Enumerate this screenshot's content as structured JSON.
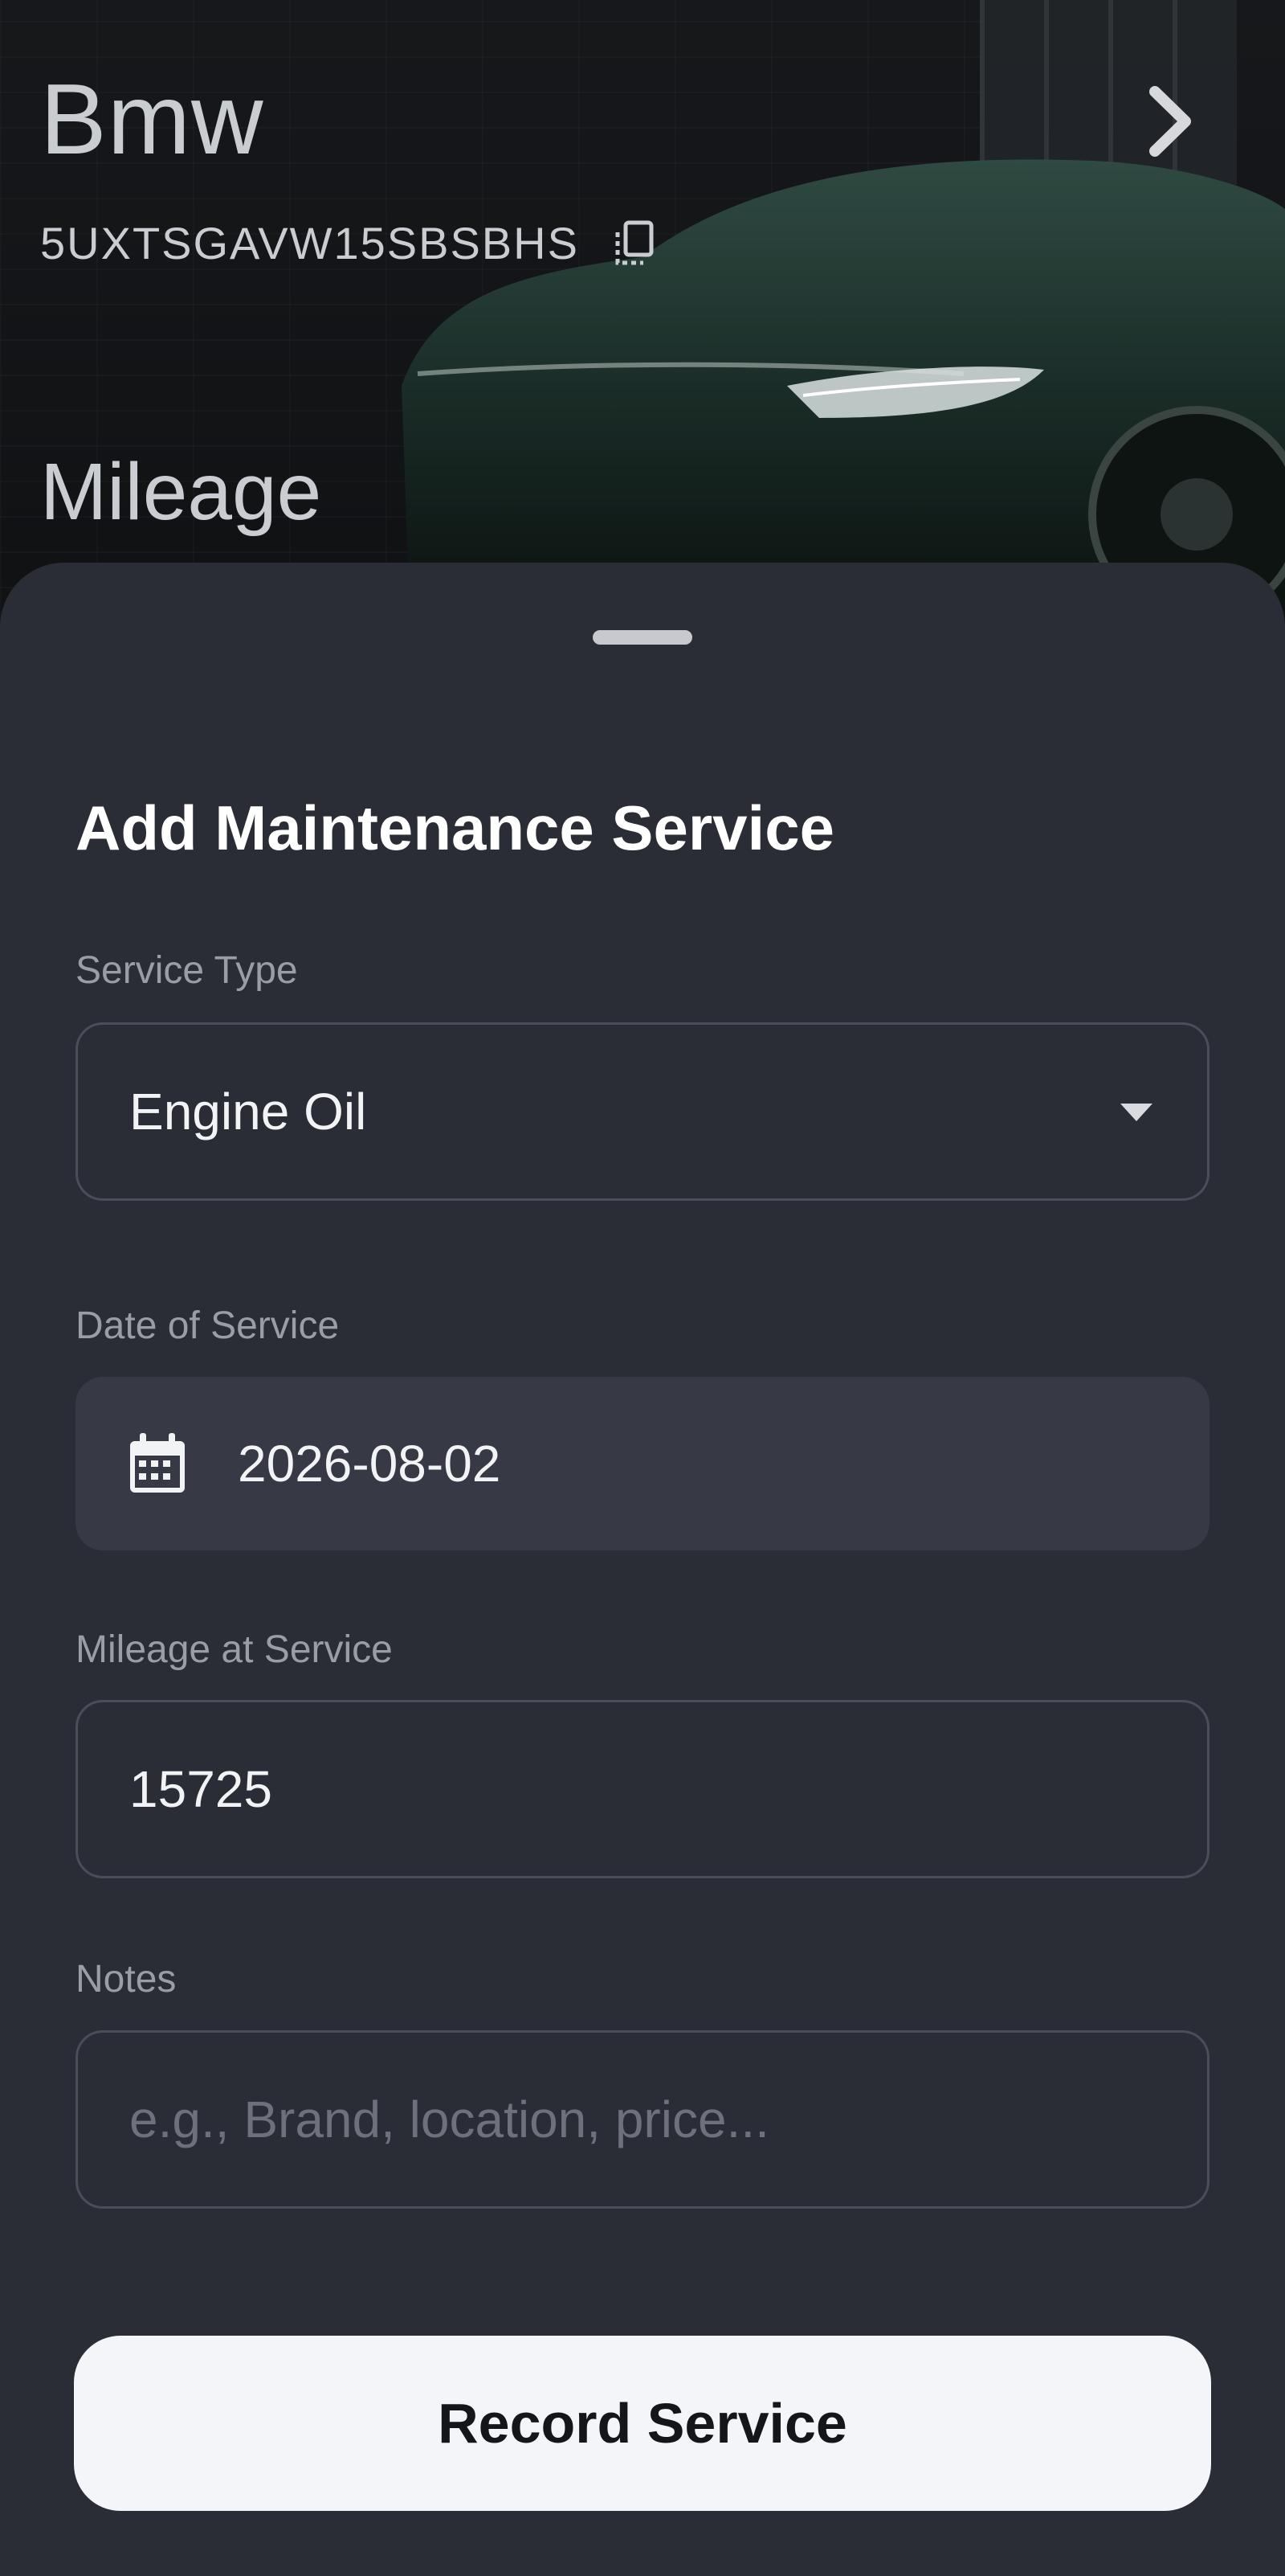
{
  "vehicle": {
    "name": "Bmw",
    "vin": "5UXTSGAVW15SBSBHS",
    "mileage_label": "Mileage"
  },
  "sheet": {
    "title": "Add Maintenance Service",
    "service_type": {
      "label": "Service Type",
      "value": "Engine Oil"
    },
    "date_of_service": {
      "label": "Date of Service",
      "value": "2026-08-02"
    },
    "mileage_at_service": {
      "label": "Mileage at Service",
      "value": "15725"
    },
    "notes": {
      "label": "Notes",
      "placeholder": "e.g., Brand, location, price..."
    },
    "submit_label": "Record Service"
  },
  "icons": {
    "next": "chevron-right-icon",
    "copy": "copy-icon",
    "dropdown": "dropdown-arrow-icon",
    "calendar": "calendar-icon"
  },
  "colors": {
    "sheet_background": "#2a2d35",
    "field_border": "#4a4e58",
    "filled_field": "#373a44",
    "button_background": "#f4f5f8",
    "button_text": "#15161a"
  }
}
